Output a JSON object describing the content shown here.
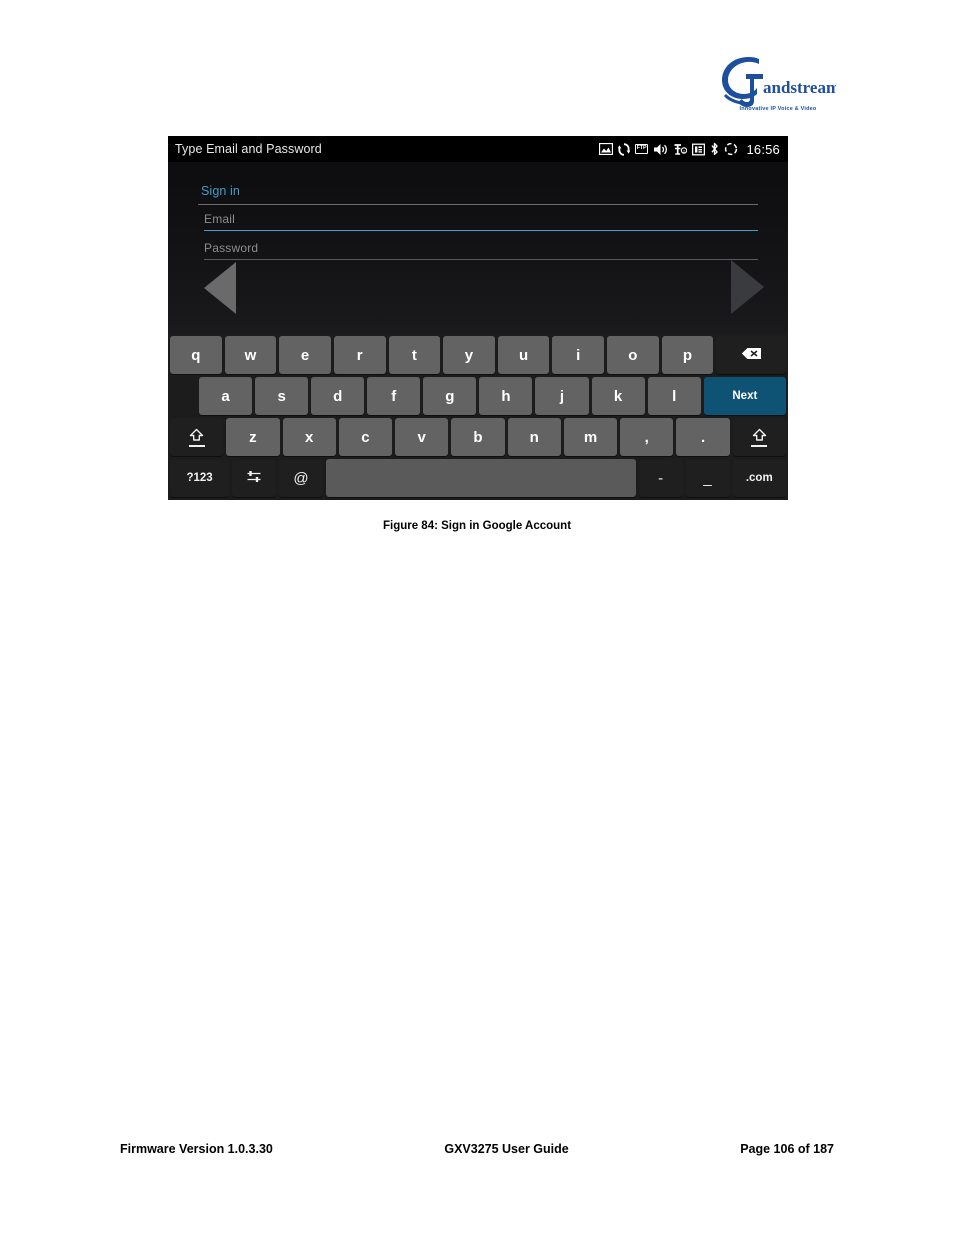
{
  "brand": {
    "name": "Grandstream",
    "tagline": "Innovative IP Voice & Video",
    "logo_color": "#1d4f9e"
  },
  "device": {
    "statusbar": {
      "title": "Type Email and Password",
      "clock": "16:56",
      "icons": [
        {
          "name": "picture-icon",
          "glyph": "image"
        },
        {
          "name": "sync-icon",
          "glyph": "sync"
        },
        {
          "name": "ftp-icon",
          "glyph": "FTP"
        },
        {
          "name": "volume-icon",
          "glyph": "volume"
        },
        {
          "name": "headset-icon",
          "glyph": "headset"
        },
        {
          "name": "sim-card-icon",
          "glyph": "sim"
        },
        {
          "name": "bluetooth-icon",
          "glyph": "bluetooth"
        },
        {
          "name": "loading-icon",
          "glyph": "loading"
        }
      ]
    },
    "form": {
      "heading": "Sign in",
      "email_placeholder": "Email",
      "email_value": "",
      "password_placeholder": "Password",
      "password_value": "",
      "accent_color": "#3f9ecb"
    },
    "nav": {
      "back_label": "back-arrow",
      "next_label": "next-arrow"
    },
    "keyboard": {
      "rows": [
        [
          {
            "label": "q",
            "type": "letter",
            "name": "key-q"
          },
          {
            "label": "w",
            "type": "letter",
            "name": "key-w"
          },
          {
            "label": "e",
            "type": "letter",
            "name": "key-e"
          },
          {
            "label": "r",
            "type": "letter",
            "name": "key-r"
          },
          {
            "label": "t",
            "type": "letter",
            "name": "key-t"
          },
          {
            "label": "y",
            "type": "letter",
            "name": "key-y"
          },
          {
            "label": "u",
            "type": "letter",
            "name": "key-u"
          },
          {
            "label": "i",
            "type": "letter",
            "name": "key-i"
          },
          {
            "label": "o",
            "type": "letter",
            "name": "key-o"
          },
          {
            "label": "p",
            "type": "letter",
            "name": "key-p"
          },
          {
            "label": "",
            "type": "backspace",
            "name": "key-backspace"
          }
        ],
        [
          {
            "label": "a",
            "type": "letter",
            "name": "key-a"
          },
          {
            "label": "s",
            "type": "letter",
            "name": "key-s"
          },
          {
            "label": "d",
            "type": "letter",
            "name": "key-d"
          },
          {
            "label": "f",
            "type": "letter",
            "name": "key-f"
          },
          {
            "label": "g",
            "type": "letter",
            "name": "key-g"
          },
          {
            "label": "h",
            "type": "letter",
            "name": "key-h"
          },
          {
            "label": "j",
            "type": "letter",
            "name": "key-j"
          },
          {
            "label": "k",
            "type": "letter",
            "name": "key-k"
          },
          {
            "label": "l",
            "type": "letter",
            "name": "key-l"
          },
          {
            "label": "Next",
            "type": "accent",
            "name": "key-next"
          }
        ],
        [
          {
            "label": "",
            "type": "shift",
            "name": "key-shift-left"
          },
          {
            "label": "z",
            "type": "letter",
            "name": "key-z"
          },
          {
            "label": "x",
            "type": "letter",
            "name": "key-x"
          },
          {
            "label": "c",
            "type": "letter",
            "name": "key-c"
          },
          {
            "label": "v",
            "type": "letter",
            "name": "key-v"
          },
          {
            "label": "b",
            "type": "letter",
            "name": "key-b"
          },
          {
            "label": "n",
            "type": "letter",
            "name": "key-n"
          },
          {
            "label": "m",
            "type": "letter",
            "name": "key-m"
          },
          {
            "label": ",",
            "type": "letter",
            "name": "key-comma"
          },
          {
            "label": ".",
            "type": "letter",
            "name": "key-period"
          },
          {
            "label": "",
            "type": "shift",
            "name": "key-shift-right"
          }
        ],
        [
          {
            "label": "?123",
            "type": "dark-small",
            "name": "key-symbols"
          },
          {
            "label": "",
            "type": "settings",
            "name": "key-keyboard-settings"
          },
          {
            "label": "@",
            "type": "dark",
            "name": "key-at"
          },
          {
            "label": "",
            "type": "space",
            "name": "key-space"
          },
          {
            "label": "-",
            "type": "dark",
            "name": "key-hyphen"
          },
          {
            "label": "_",
            "type": "dark",
            "name": "key-underscore"
          },
          {
            "label": ".com",
            "type": "dark-small",
            "name": "key-dotcom"
          }
        ]
      ],
      "accent_color": "#0f5374",
      "key_color": "#636363"
    }
  },
  "figure": {
    "caption": "Figure 84: Sign in Google Account"
  },
  "footer": {
    "left": "Firmware Version 1.0.3.30",
    "center": "GXV3275 User Guide",
    "right": "Page 106 of 187"
  }
}
